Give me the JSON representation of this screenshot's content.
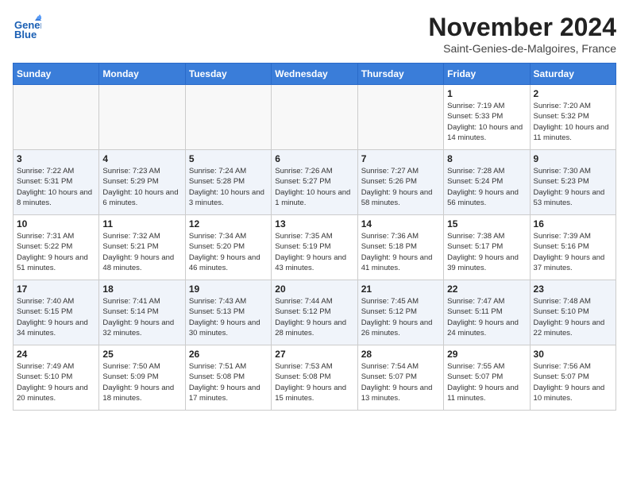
{
  "header": {
    "logo_line1": "General",
    "logo_line2": "Blue",
    "title": "November 2024",
    "subtitle": "Saint-Genies-de-Malgoires, France"
  },
  "calendar": {
    "weekdays": [
      "Sunday",
      "Monday",
      "Tuesday",
      "Wednesday",
      "Thursday",
      "Friday",
      "Saturday"
    ],
    "weeks": [
      [
        {
          "day": "",
          "info": ""
        },
        {
          "day": "",
          "info": ""
        },
        {
          "day": "",
          "info": ""
        },
        {
          "day": "",
          "info": ""
        },
        {
          "day": "",
          "info": ""
        },
        {
          "day": "1",
          "info": "Sunrise: 7:19 AM\nSunset: 5:33 PM\nDaylight: 10 hours and 14 minutes."
        },
        {
          "day": "2",
          "info": "Sunrise: 7:20 AM\nSunset: 5:32 PM\nDaylight: 10 hours and 11 minutes."
        }
      ],
      [
        {
          "day": "3",
          "info": "Sunrise: 7:22 AM\nSunset: 5:31 PM\nDaylight: 10 hours and 8 minutes."
        },
        {
          "day": "4",
          "info": "Sunrise: 7:23 AM\nSunset: 5:29 PM\nDaylight: 10 hours and 6 minutes."
        },
        {
          "day": "5",
          "info": "Sunrise: 7:24 AM\nSunset: 5:28 PM\nDaylight: 10 hours and 3 minutes."
        },
        {
          "day": "6",
          "info": "Sunrise: 7:26 AM\nSunset: 5:27 PM\nDaylight: 10 hours and 1 minute."
        },
        {
          "day": "7",
          "info": "Sunrise: 7:27 AM\nSunset: 5:26 PM\nDaylight: 9 hours and 58 minutes."
        },
        {
          "day": "8",
          "info": "Sunrise: 7:28 AM\nSunset: 5:24 PM\nDaylight: 9 hours and 56 minutes."
        },
        {
          "day": "9",
          "info": "Sunrise: 7:30 AM\nSunset: 5:23 PM\nDaylight: 9 hours and 53 minutes."
        }
      ],
      [
        {
          "day": "10",
          "info": "Sunrise: 7:31 AM\nSunset: 5:22 PM\nDaylight: 9 hours and 51 minutes."
        },
        {
          "day": "11",
          "info": "Sunrise: 7:32 AM\nSunset: 5:21 PM\nDaylight: 9 hours and 48 minutes."
        },
        {
          "day": "12",
          "info": "Sunrise: 7:34 AM\nSunset: 5:20 PM\nDaylight: 9 hours and 46 minutes."
        },
        {
          "day": "13",
          "info": "Sunrise: 7:35 AM\nSunset: 5:19 PM\nDaylight: 9 hours and 43 minutes."
        },
        {
          "day": "14",
          "info": "Sunrise: 7:36 AM\nSunset: 5:18 PM\nDaylight: 9 hours and 41 minutes."
        },
        {
          "day": "15",
          "info": "Sunrise: 7:38 AM\nSunset: 5:17 PM\nDaylight: 9 hours and 39 minutes."
        },
        {
          "day": "16",
          "info": "Sunrise: 7:39 AM\nSunset: 5:16 PM\nDaylight: 9 hours and 37 minutes."
        }
      ],
      [
        {
          "day": "17",
          "info": "Sunrise: 7:40 AM\nSunset: 5:15 PM\nDaylight: 9 hours and 34 minutes."
        },
        {
          "day": "18",
          "info": "Sunrise: 7:41 AM\nSunset: 5:14 PM\nDaylight: 9 hours and 32 minutes."
        },
        {
          "day": "19",
          "info": "Sunrise: 7:43 AM\nSunset: 5:13 PM\nDaylight: 9 hours and 30 minutes."
        },
        {
          "day": "20",
          "info": "Sunrise: 7:44 AM\nSunset: 5:12 PM\nDaylight: 9 hours and 28 minutes."
        },
        {
          "day": "21",
          "info": "Sunrise: 7:45 AM\nSunset: 5:12 PM\nDaylight: 9 hours and 26 minutes."
        },
        {
          "day": "22",
          "info": "Sunrise: 7:47 AM\nSunset: 5:11 PM\nDaylight: 9 hours and 24 minutes."
        },
        {
          "day": "23",
          "info": "Sunrise: 7:48 AM\nSunset: 5:10 PM\nDaylight: 9 hours and 22 minutes."
        }
      ],
      [
        {
          "day": "24",
          "info": "Sunrise: 7:49 AM\nSunset: 5:10 PM\nDaylight: 9 hours and 20 minutes."
        },
        {
          "day": "25",
          "info": "Sunrise: 7:50 AM\nSunset: 5:09 PM\nDaylight: 9 hours and 18 minutes."
        },
        {
          "day": "26",
          "info": "Sunrise: 7:51 AM\nSunset: 5:08 PM\nDaylight: 9 hours and 17 minutes."
        },
        {
          "day": "27",
          "info": "Sunrise: 7:53 AM\nSunset: 5:08 PM\nDaylight: 9 hours and 15 minutes."
        },
        {
          "day": "28",
          "info": "Sunrise: 7:54 AM\nSunset: 5:07 PM\nDaylight: 9 hours and 13 minutes."
        },
        {
          "day": "29",
          "info": "Sunrise: 7:55 AM\nSunset: 5:07 PM\nDaylight: 9 hours and 11 minutes."
        },
        {
          "day": "30",
          "info": "Sunrise: 7:56 AM\nSunset: 5:07 PM\nDaylight: 9 hours and 10 minutes."
        }
      ]
    ]
  }
}
